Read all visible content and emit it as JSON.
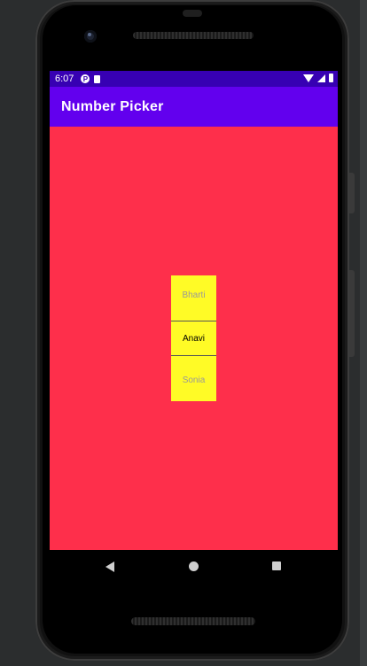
{
  "status_bar": {
    "time": "6:07",
    "p_icon_glyph": "P"
  },
  "app_bar": {
    "title": "Number Picker"
  },
  "picker": {
    "prev": "Bharti",
    "current": "Anavi",
    "next": "Sonia"
  },
  "colors": {
    "status_bar": "#3700b3",
    "app_bar": "#6200ee",
    "content_bg": "#fe2f4b",
    "picker_bg": "#fffb26"
  },
  "icons": [
    "wifi-icon",
    "signal-icon",
    "battery-icon",
    "back-icon",
    "home-icon",
    "recents-icon"
  ]
}
